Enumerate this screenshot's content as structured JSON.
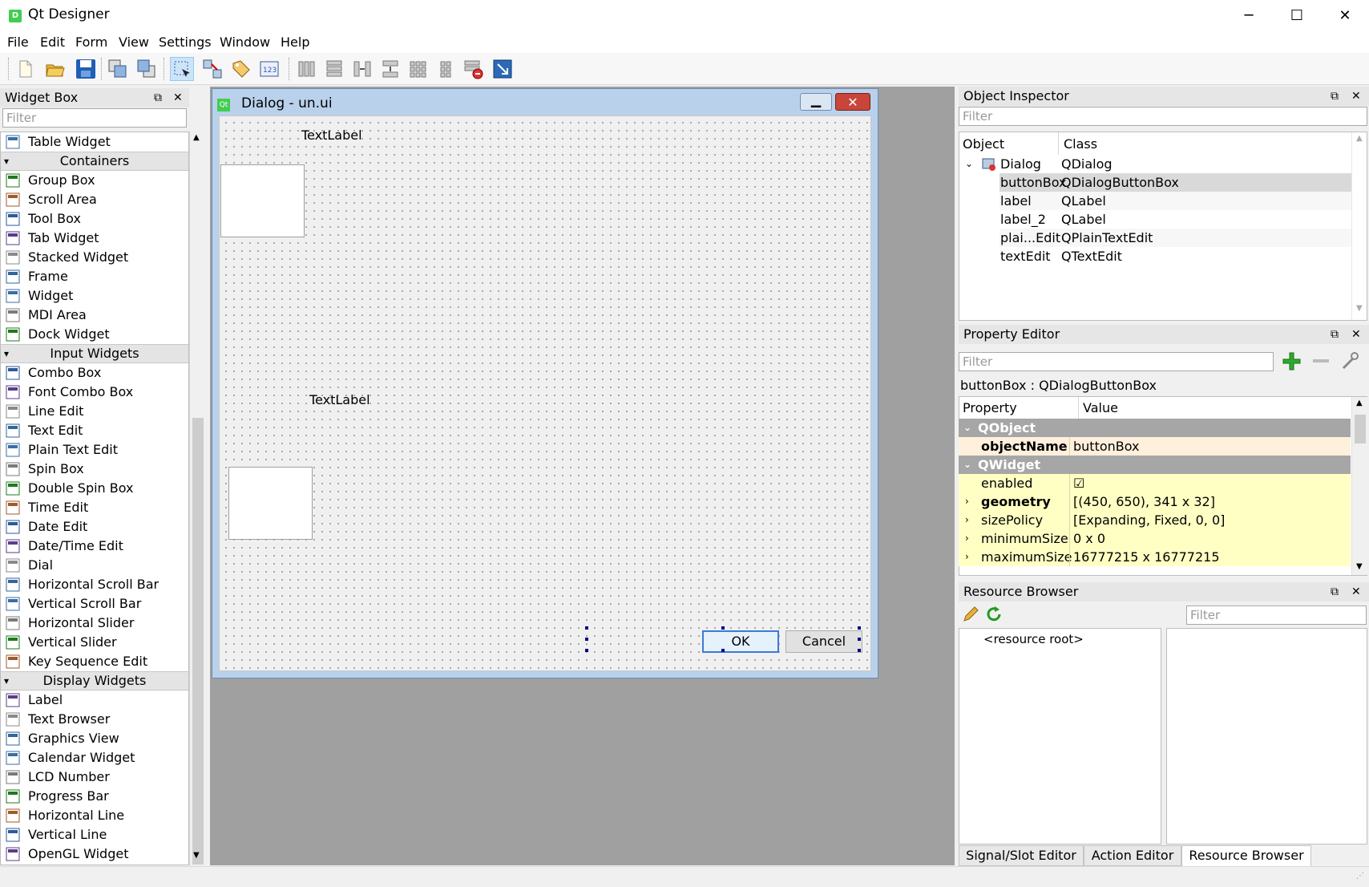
{
  "window": {
    "title": "Qt Designer",
    "app_icon_letter": "D",
    "controls": [
      "─",
      "☐",
      "✕"
    ]
  },
  "menu": [
    "File",
    "Edit",
    "Form",
    "View",
    "Settings",
    "Window",
    "Help"
  ],
  "toolbar": {
    "icons": [
      "new-file-icon",
      "open-folder-icon",
      "save-icon",
      "send-to-back-icon",
      "bring-to-front-icon",
      "edit-widgets-icon",
      "edit-signals-slots-icon",
      "edit-buddies-icon",
      "edit-tab-order-icon",
      "layout-horizontal-icon",
      "layout-vertical-icon",
      "layout-horizontal-splitter-icon",
      "layout-vertical-splitter-icon",
      "layout-grid-icon",
      "layout-form-icon",
      "break-layout-icon",
      "adjust-size-icon"
    ]
  },
  "widget_box": {
    "title": "Widget Box",
    "filter_placeholder": "Filter",
    "items": [
      {
        "type": "item",
        "label": "Table Widget",
        "icon": "table-icon"
      },
      {
        "type": "category",
        "label": "Containers"
      },
      {
        "type": "item",
        "label": "Group Box",
        "icon": "group-box-icon"
      },
      {
        "type": "item",
        "label": "Scroll Area",
        "icon": "scroll-area-icon"
      },
      {
        "type": "item",
        "label": "Tool Box",
        "icon": "tool-box-icon"
      },
      {
        "type": "item",
        "label": "Tab Widget",
        "icon": "tab-widget-icon"
      },
      {
        "type": "item",
        "label": "Stacked Widget",
        "icon": "stacked-widget-icon"
      },
      {
        "type": "item",
        "label": "Frame",
        "icon": "frame-icon"
      },
      {
        "type": "item",
        "label": "Widget",
        "icon": "widget-icon"
      },
      {
        "type": "item",
        "label": "MDI Area",
        "icon": "mdi-area-icon"
      },
      {
        "type": "item",
        "label": "Dock Widget",
        "icon": "dock-widget-icon"
      },
      {
        "type": "category",
        "label": "Input Widgets"
      },
      {
        "type": "item",
        "label": "Combo Box",
        "icon": "combo-box-icon"
      },
      {
        "type": "item",
        "label": "Font Combo Box",
        "icon": "font-combo-box-icon"
      },
      {
        "type": "item",
        "label": "Line Edit",
        "icon": "line-edit-icon"
      },
      {
        "type": "item",
        "label": "Text Edit",
        "icon": "text-edit-icon"
      },
      {
        "type": "item",
        "label": "Plain Text Edit",
        "icon": "plain-text-edit-icon"
      },
      {
        "type": "item",
        "label": "Spin Box",
        "icon": "spin-box-icon"
      },
      {
        "type": "item",
        "label": "Double Spin Box",
        "icon": "double-spin-box-icon"
      },
      {
        "type": "item",
        "label": "Time Edit",
        "icon": "clock-icon"
      },
      {
        "type": "item",
        "label": "Date Edit",
        "icon": "calendar-icon"
      },
      {
        "type": "item",
        "label": "Date/Time Edit",
        "icon": "date-time-icon"
      },
      {
        "type": "item",
        "label": "Dial",
        "icon": "dial-icon"
      },
      {
        "type": "item",
        "label": "Horizontal Scroll Bar",
        "icon": "hscrollbar-icon"
      },
      {
        "type": "item",
        "label": "Vertical Scroll Bar",
        "icon": "vscrollbar-icon"
      },
      {
        "type": "item",
        "label": "Horizontal Slider",
        "icon": "hslider-icon"
      },
      {
        "type": "item",
        "label": "Vertical Slider",
        "icon": "vslider-icon"
      },
      {
        "type": "item",
        "label": "Key Sequence Edit",
        "icon": "key-sequence-icon"
      },
      {
        "type": "category",
        "label": "Display Widgets"
      },
      {
        "type": "item",
        "label": "Label",
        "icon": "label-tag-icon"
      },
      {
        "type": "item",
        "label": "Text Browser",
        "icon": "text-browser-icon"
      },
      {
        "type": "item",
        "label": "Graphics View",
        "icon": "graphics-view-icon"
      },
      {
        "type": "item",
        "label": "Calendar Widget",
        "icon": "calendar-widget-icon"
      },
      {
        "type": "item",
        "label": "LCD Number",
        "icon": "lcd-number-icon"
      },
      {
        "type": "item",
        "label": "Progress Bar",
        "icon": "progress-bar-icon"
      },
      {
        "type": "item",
        "label": "Horizontal Line",
        "icon": "hline-icon"
      },
      {
        "type": "item",
        "label": "Vertical Line",
        "icon": "vline-icon"
      },
      {
        "type": "item",
        "label": "OpenGL Widget",
        "icon": "opengl-icon"
      }
    ]
  },
  "form": {
    "title": "Dialog - un.ui",
    "qt_badge": "Qt",
    "label1": "TextLabel",
    "label2": "TextLabel",
    "ok_button": "OK",
    "cancel_button": "Cancel"
  },
  "object_inspector": {
    "title": "Object Inspector",
    "filter_placeholder": "Filter",
    "col_object": "Object",
    "col_class": "Class",
    "rows": [
      {
        "object": "Dialog",
        "class": "QDialog"
      },
      {
        "object": "buttonBox",
        "class": "QDialogButtonBox"
      },
      {
        "object": "label",
        "class": "QLabel"
      },
      {
        "object": "label_2",
        "class": "QLabel"
      },
      {
        "object": "plai...Edit",
        "class": "QPlainTextEdit"
      },
      {
        "object": "textEdit",
        "class": "QTextEdit"
      }
    ],
    "selected": "buttonBox"
  },
  "property_editor": {
    "title": "Property Editor",
    "filter_placeholder": "Filter",
    "context": "buttonBox : QDialogButtonBox",
    "col_property": "Property",
    "col_value": "Value",
    "rows": [
      {
        "kind": "cat",
        "name": "QObject"
      },
      {
        "kind": "prop",
        "name": "objectName",
        "value": "buttonBox",
        "bold": true,
        "bg": "orange"
      },
      {
        "kind": "cat",
        "name": "QWidget"
      },
      {
        "kind": "prop",
        "name": "enabled",
        "value": "☑",
        "bold": false,
        "bg": "yellow"
      },
      {
        "kind": "prop",
        "name": "geometry",
        "value": "[(450, 650), 341 x 32]",
        "bold": true,
        "bg": "yellow",
        "expand": true
      },
      {
        "kind": "prop",
        "name": "sizePolicy",
        "value": "[Expanding, Fixed, 0, 0]",
        "bold": false,
        "bg": "yellow",
        "expand": true
      },
      {
        "kind": "prop",
        "name": "minimumSize",
        "value": "0 x 0",
        "bold": false,
        "bg": "yellow",
        "expand": true
      },
      {
        "kind": "prop",
        "name": "maximumSize",
        "value": "16777215 x 16777215",
        "bold": false,
        "bg": "yellow",
        "expand": true
      }
    ]
  },
  "resource_browser": {
    "title": "Resource Browser",
    "filter_placeholder": "Filter",
    "root": "<resource root>"
  },
  "bottom_tabs": [
    "Signal/Slot Editor",
    "Action Editor",
    "Resource Browser"
  ],
  "colors": {
    "qt_green": "#41cd52",
    "selection": "#cce4f7",
    "category_gray": "#a6a6a6",
    "property_yellow": "#ffffc4",
    "canvas_gray": "#a0a0a0"
  }
}
